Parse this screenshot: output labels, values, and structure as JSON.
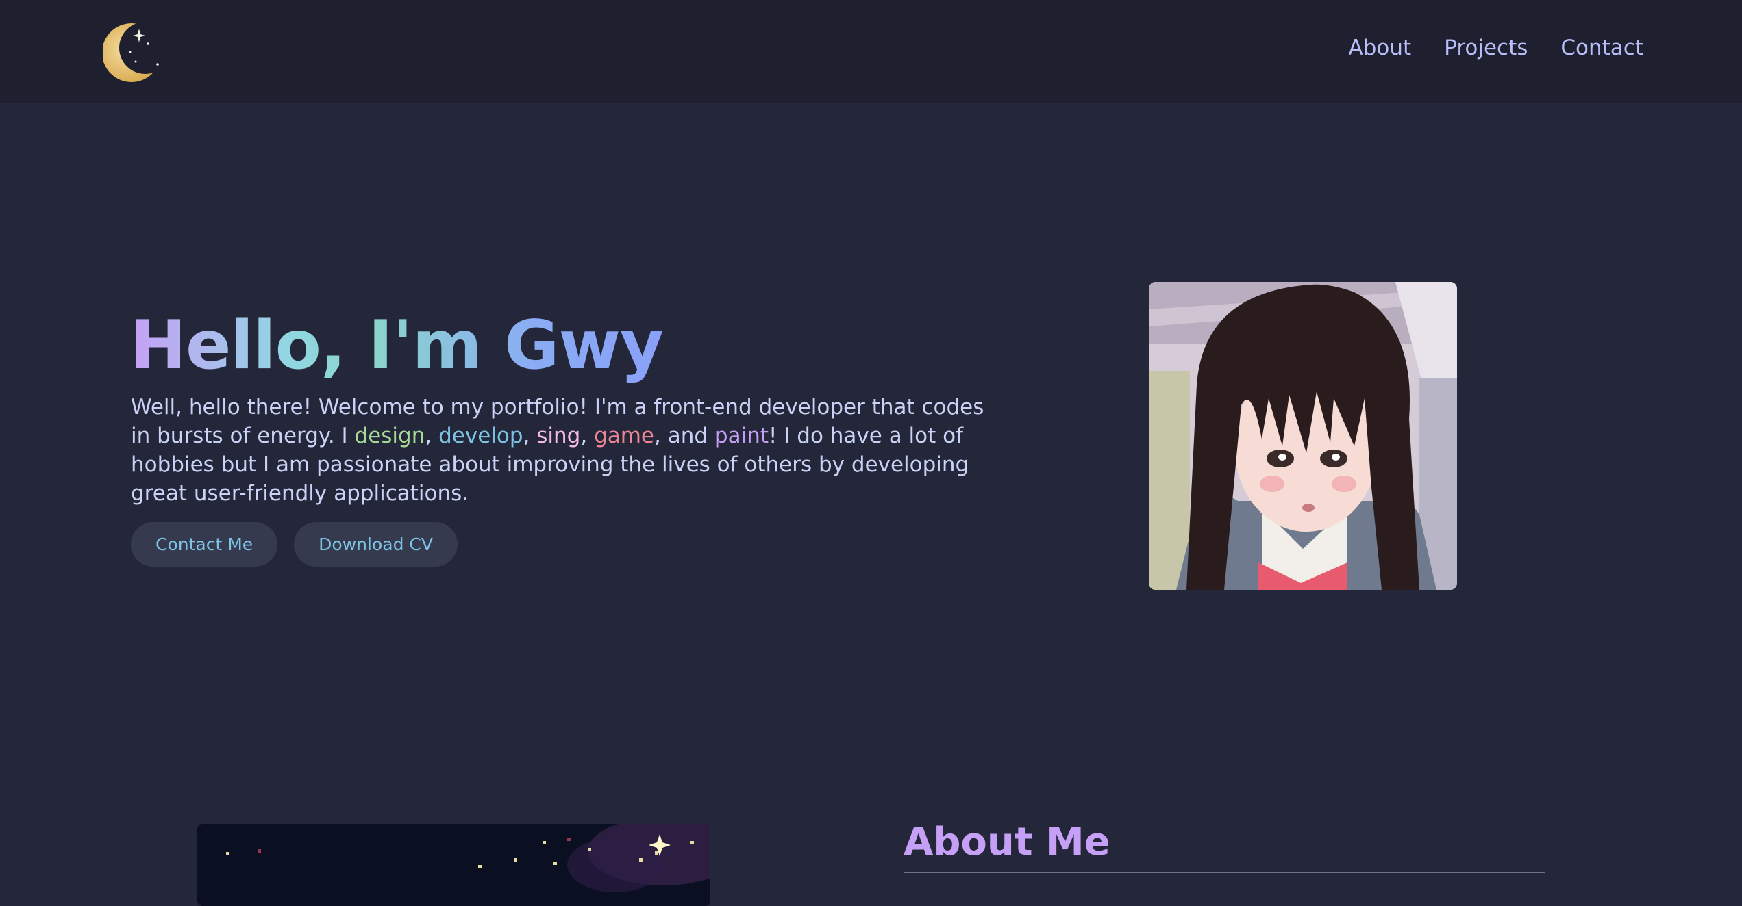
{
  "nav": {
    "items": [
      "About",
      "Projects",
      "Contact"
    ]
  },
  "hero": {
    "title": "Hello, I'm Gwy",
    "text_a": "Well, hello there! Welcome to my portfolio! I'm a front-end developer that codes in bursts of energy. I ",
    "design": "design",
    "sep1": ", ",
    "develop": "develop",
    "sep2": ", ",
    "sing": "sing",
    "sep3": ", ",
    "game": "game",
    "sep4": ", and ",
    "paint": "paint",
    "text_b": "! I do have a lot of hobbies but I am passionate about improving the lives of others by developing great user-friendly applications.",
    "contact_button": "Contact Me",
    "cv_button": "Download CV"
  },
  "about": {
    "title": "About Me"
  },
  "icons": {
    "logo": "crescent-moon-icon"
  },
  "colors": {
    "background": "#24273a",
    "header": "#1e2030",
    "accent_purple": "#c6a0f6",
    "accent_blue": "#7dc4e4",
    "accent_green": "#a6da95",
    "accent_pink": "#f5bde6",
    "accent_red": "#ed8796"
  }
}
